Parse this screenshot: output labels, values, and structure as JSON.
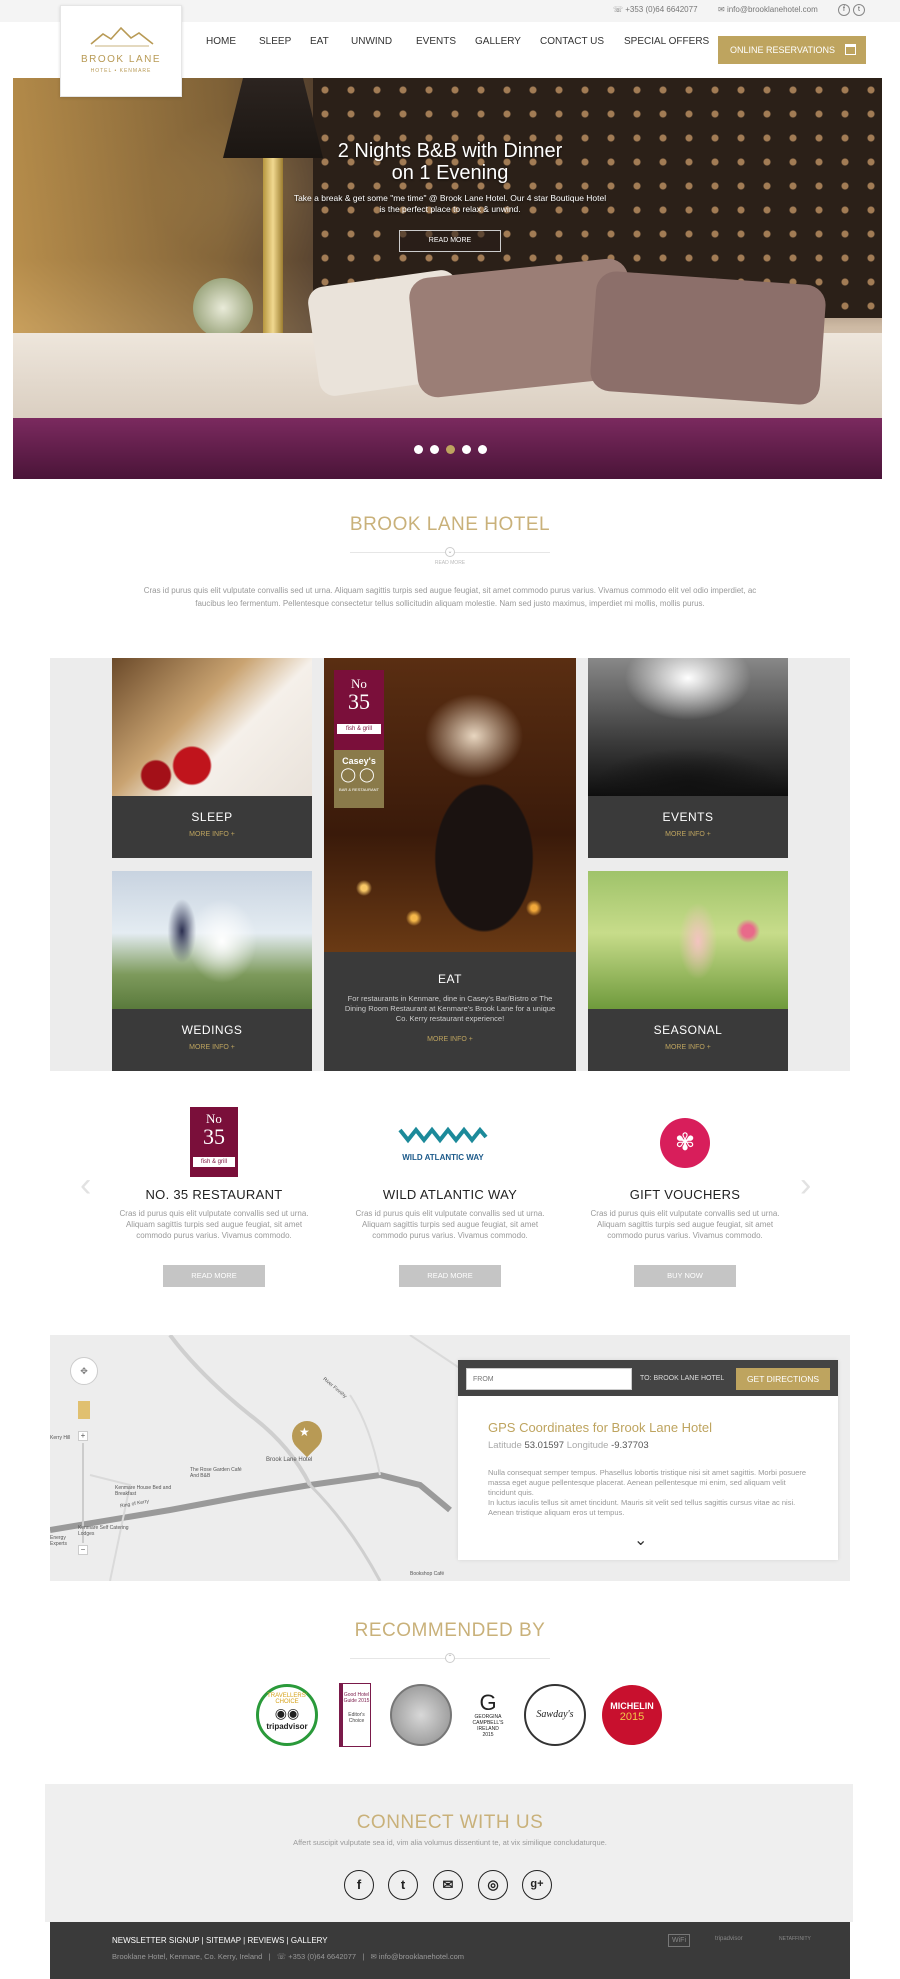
{
  "topbar": {
    "phone": "+353 (0)64 6642077",
    "email": "info@brooklanehotel.com",
    "social": [
      "f",
      "t"
    ]
  },
  "logo": {
    "name": "BROOK LANE",
    "sub": "HOTEL • KENMARE"
  },
  "nav": {
    "items": [
      "HOME",
      "SLEEP",
      "EAT",
      "UNWIND",
      "EVENTS",
      "GALLERY",
      "CONTACT US",
      "SPECIAL OFFERS"
    ],
    "reservations": "ONLINE RESERVATIONS"
  },
  "hero": {
    "title_line1": "2 Nights B&B with Dinner",
    "title_line2": "on 1 Evening",
    "text": "Take a break & get some \"me time\" @ Brook Lane Hotel. Our 4 star Boutique Hotel is the perfect place to relax & unwind.",
    "button": "READ MORE",
    "slides": 5,
    "active_slide": 3
  },
  "intro": {
    "title": "BROOK LANE HOTEL",
    "read_more": "READ MORE",
    "text": "Cras id purus quis elit vulputate convallis sed ut urna. Aliquam sagittis turpis sed augue feugiat, sit amet commodo purus varius. Vivamus commodo elit vel odio imperdiet, ac faucibus leo fermentum. Pellentesque consectetur tellus sollicitudin aliquam molestie. Nam sed justo maximus, imperdiet mi mollis, mollis purus."
  },
  "grid": {
    "more_info": "MORE INFO +",
    "tiles": {
      "sleep": "SLEEP",
      "events": "EVENTS",
      "weddings": "WEDINGS",
      "seasonal": "SEASONAL",
      "eat": "EAT",
      "eat_desc": "For restaurants in Kenmare, dine in Casey's Bar/Bistro or The Dining Room Restaurant at Kenmare's Brook Lane for a unique Co. Kerry restaurant experience!"
    },
    "no35_logo": {
      "top": "No",
      "num": "35",
      "sub": "fish & grill"
    },
    "caseys_logo": {
      "name": "Casey's",
      "sub": "BAR & RESTAURANT"
    }
  },
  "features": [
    {
      "title": "NO. 35 RESTAURANT",
      "text": "Cras id purus quis elit vulputate convallis sed ut urna. Aliquam sagittis turpis sed augue feugiat, sit amet commodo purus varius. Vivamus commodo.",
      "button": "READ MORE"
    },
    {
      "title": "WILD ATLANTIC WAY",
      "text": "Cras id purus quis elit vulputate convallis sed ut urna. Aliquam sagittis turpis sed augue feugiat, sit amet commodo purus varius. Vivamus commodo.",
      "button": "READ MORE"
    },
    {
      "title": "GIFT VOUCHERS",
      "text": "Cras id purus quis elit vulputate convallis sed ut urna. Aliquam sagittis turpis sed augue feugiat, sit amet commodo purus varius. Vivamus commodo.",
      "button": "BUY NOW"
    }
  ],
  "wild_atlantic_logo": "WILD ATLANTIC WAY",
  "map": {
    "from_placeholder": "FROM",
    "to": "TO: BROOK LANE HOTEL",
    "get_directions": "GET DIRECTIONS",
    "gps_title": "GPS Coordinates for Brook Lane Hotel",
    "latitude_label": "Latitude",
    "latitude": "53.01597",
    "longitude_label": "Longitude",
    "longitude": "-9.37703",
    "text1": "Nulla consequat semper tempus. Phasellus lobortis tristique nisi sit amet sagittis. Morbi posuere massa eget augue pellentesque placerat. Aenean pellentesque mi enim, sed aliquam velit tincidunt quis.",
    "text2": "In luctus iaculis tellus sit amet tincidunt. Mauris sit velit sed tellus sagittis cursus vitae ac nisi. Aenean tristique aliquam eros ut tempus.",
    "labels": [
      "Kenmare House Bed and Breakfast",
      "The Rose Garden Café And B&B",
      "Brook Lane Hotel",
      "Kenmare Self Catering Lodges",
      "Energy Experts",
      "Bookshop Café",
      "Kerry Hill",
      "Ring of Kerry",
      "River Finnihy"
    ]
  },
  "recommended": {
    "title": "RECOMMENDED BY",
    "badges": {
      "tripadvisor_top": "TRAVELLERS' CHOICE",
      "tripadvisor": "tripadvisor",
      "goodhotel": "Good Hotel Guide 2015",
      "goodhotel_sub": "Editor's Choice",
      "georgina": "GEORGINA CAMPBELL'S IRELAND 2015",
      "sawdays": "Sawday's",
      "michelin": "MICHELIN",
      "michelin_year": "2015"
    }
  },
  "connect": {
    "title": "CONNECT WITH US",
    "text": "Affert suscipit vulputate sea id, vim alia volumus dissentiunt te, at vix similique concludaturque.",
    "icons": [
      "f",
      "t",
      "✉",
      "◎",
      "g+"
    ]
  },
  "footer": {
    "links": "NEWSLETTER SIGNUP   |   SITEMAP   |   REVIEWS   |   GALLERY",
    "address": "Brooklane Hotel, Kenmare, Co. Kerry, Ireland",
    "phone": "+353 (0)64 6642077",
    "email": "info@brooklanehotel.com",
    "logos": [
      "WiFi",
      "tripadvisor",
      "NETAFFINITY"
    ]
  },
  "colors": {
    "gold": "#bea45f",
    "dark": "#3a3a3a",
    "maroon": "#7a0f3a",
    "teal": "#1c8a9a",
    "pink": "#d81e5b"
  }
}
